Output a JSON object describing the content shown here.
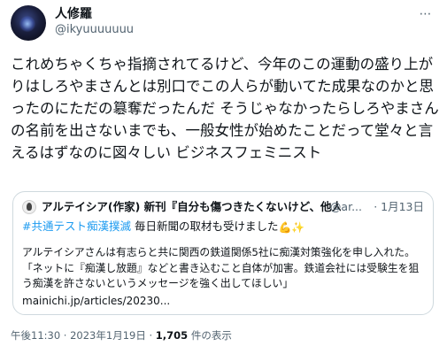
{
  "author": {
    "display_name": "人修羅",
    "handle": "@ikyuuuuuuu"
  },
  "more_icon": "⋯",
  "tweet_text": "これめちゃくちゃ指摘されてるけど、今年のこの運動の盛り上がりはしろやまさんとは別口でこの人らが動いてた成果なのかと思ったのにただの簒奪だったんだ そうじゃなかったらしろやまさんの名前を出さないまでも、一般女性が始めたことだって堂々と言えるはずなのに図々しい ビジネスフェミニスト",
  "quoted": {
    "name": "アルテイシア(作家) 新刊『自分も傷つきたくないけど、他人も...",
    "handle": "@ar...",
    "date": "· 1月13日",
    "hashtags": "#共通テスト痴漢撲滅",
    "line1_rest": " 毎日新聞の取材も受けました",
    "emoji_icons": [
      "muscle-emoji",
      "sparkles-emoji"
    ],
    "paragraph": "アルテイシアさんは有志らと共に関西の鉄道関係5社に痴漢対策強化を申し入れた。「ネットに『痴漢し放題』などと書き込むこと自体が加害。鉄道会社には受験生を狙う痴漢を許さないというメッセージを強く出してほしい」",
    "link": "mainichi.jp/articles/20230..."
  },
  "meta": {
    "time_date": "午後11:30 · 2023年1月19日 · ",
    "views_count": "1,705",
    "views_label": " 件の表示"
  },
  "colors": {
    "text": "#0f1419",
    "secondary": "#536471",
    "link": "#1d9bf0",
    "border": "#cfd9de"
  }
}
